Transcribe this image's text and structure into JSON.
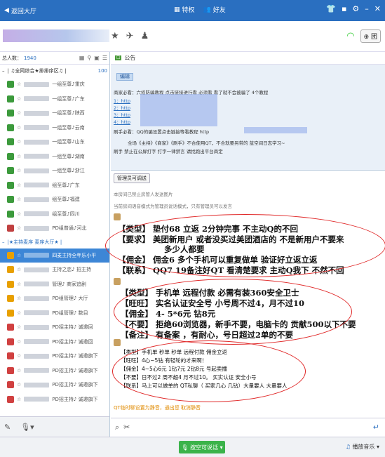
{
  "topbar": {
    "back_label": "返回大厅",
    "tab_privilege": "特权",
    "tab_friends": "好友",
    "icons": [
      "tshirt-icon",
      "chat-icon",
      "settings-icon",
      "minimize-icon",
      "close-icon"
    ]
  },
  "sidebar": {
    "online_label": "总人数：",
    "online_count": "1940",
    "group1_label": "| ♫全网综合★排排序区♫ |",
    "group1_count": "100",
    "group2_label": "|★主持麦序 麦序大厅★ |",
    "members": [
      {
        "name": "一组至尊♪重庆",
        "color": "#3c9a3c"
      },
      {
        "name": "一组至尊♪广东",
        "color": "#3c9a3c"
      },
      {
        "name": "一组至尊♪陕西",
        "color": "#3c9a3c"
      },
      {
        "name": "一组至尊♪云南",
        "color": "#3c9a3c"
      },
      {
        "name": "一组至尊♪山东",
        "color": "#3c9a3c"
      },
      {
        "name": "一组至尊♪湖南",
        "color": "#3c9a3c"
      },
      {
        "name": "一组至尊♪浙江",
        "color": "#3c9a3c"
      },
      {
        "name": "组至尊♪广东",
        "color": "#3c9a3c"
      },
      {
        "name": "组至尊♪福建",
        "color": "#3c9a3c"
      },
      {
        "name": "组至尊♪四川",
        "color": "#3c9a3c"
      },
      {
        "name": "PD组普通♪河北",
        "color": "#c04040"
      }
    ],
    "hosts": [
      {
        "name": "四麦主持全年乐小平",
        "color": "#e8a000"
      },
      {
        "name": "主持之恋♪ 招主持",
        "color": "#e8a000"
      },
      {
        "name": "管理♪ 商家追剧",
        "color": "#e8a000"
      },
      {
        "name": "PD组管理♪ 大厅",
        "color": "#e8a000"
      },
      {
        "name": "PD组管理♪ 数目",
        "color": "#e8a000"
      },
      {
        "name": "PD招主持♪ 诚邀回",
        "color": "#d04040"
      },
      {
        "name": "PD招主持♪ 诚邀回",
        "color": "#d04040"
      },
      {
        "name": "PD招主持♪ 诚邀旗下",
        "color": "#d04040"
      },
      {
        "name": "PD招主持♪ 诚邀旗下",
        "color": "#d04040"
      },
      {
        "name": "PD招主持♪ 诚邀旗下",
        "color": "#d04040"
      },
      {
        "name": "PD招主持♪ 诚邀旗下",
        "color": "#d04040"
      }
    ]
  },
  "main": {
    "tab_label": "公告",
    "edit_label": "编辑",
    "notice_line1": "商家必看：六招防骗教程 点击链接进行看 必须看 看了就不会被骗了 4个教程",
    "notice_links": [
      "1：http",
      "2：http",
      "3：http",
      "4：http"
    ],
    "notice_line6": "刷手必看：QQ的骗设置点击链接等看教程 http",
    "notice_line7": "全场《主持》《商家》《刷手》不合使用QT，不合就要另带的 蓝空间日志学习~",
    "notice_line8": "刷手 禁止在公屏打字   打字一律禁言   请找跑出平台商定",
    "mgr_label": "管理员可调送",
    "sys1": "本房间已禁止房管人发送图片",
    "sys2": "当前房间语音模式为管理员说话模式，只有管理员可以发言",
    "ad1": [
      "【类型】  垫付68 立返   2分钟完事   不主动Q的不回",
      "【要求】 美团新用户 或者没买过美团酒店的              不是新用户不要来",
      "多少人都要",
      "【佣金】 佣金6 多个手机可以重复做单 验证好立返立返",
      "【联系】 QQ7               19备注好QT 看清楚要求 主动Q我下 不然不回"
    ],
    "ad2": [
      "【类型】 手机单 远程付款   必需有装360安全卫士",
      "【旺旺】 实名认证安全号  小号周不过4，月不过10",
      "【佣金】 4- 5*6元 钻8元",
      "【不要】 拒绝60浏览器，新手不要，电脑卡的 贡献500以下不要",
      "【备注】 有备案 ，有耐心，号日超过2单的不要"
    ],
    "ad3": [
      "【类型】手机单 秒单 秒单  远程付款  佣金立返",
      "【旺旺】4心~5钻  有轻轮的才来啊！",
      "【佣金】4~5心6元 1钻7元  2钻8元  号起卖播",
      "【不要】日不过2   周不超4  月不过10。  买实认证  安全小号",
      "【联系】马上可以做单的  QT私聊（  买家几心  几钻）大量要人  大量要人"
    ],
    "footer_notice": "QT临时聊设置为静音，通出您  取消静音"
  },
  "bottom": {
    "send_label": "按空可说话",
    "music_label": "播放音乐"
  }
}
